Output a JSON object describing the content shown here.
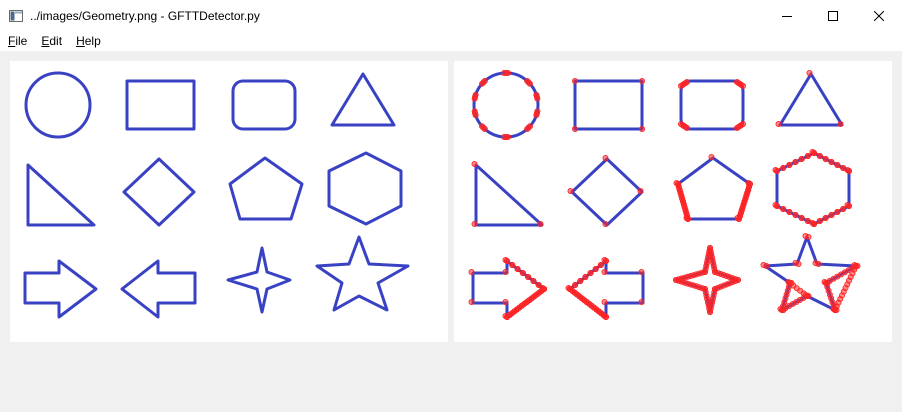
{
  "window": {
    "title": "../images/Geometry.png - GFTTDetector.py",
    "app_icon": "window-icon",
    "controls": [
      "minimize-icon",
      "maximize-icon",
      "close-icon"
    ]
  },
  "menu": {
    "items": [
      {
        "mnemonic": "F",
        "rest": "ile"
      },
      {
        "mnemonic": "E",
        "rest": "dit"
      },
      {
        "mnemonic": "H",
        "rest": "elp"
      }
    ]
  },
  "canvas": {
    "shape_color": "#3a42c4",
    "keypoint_color": "#ff2020",
    "left_image": "original shapes",
    "right_image": "shapes with detected corners"
  }
}
